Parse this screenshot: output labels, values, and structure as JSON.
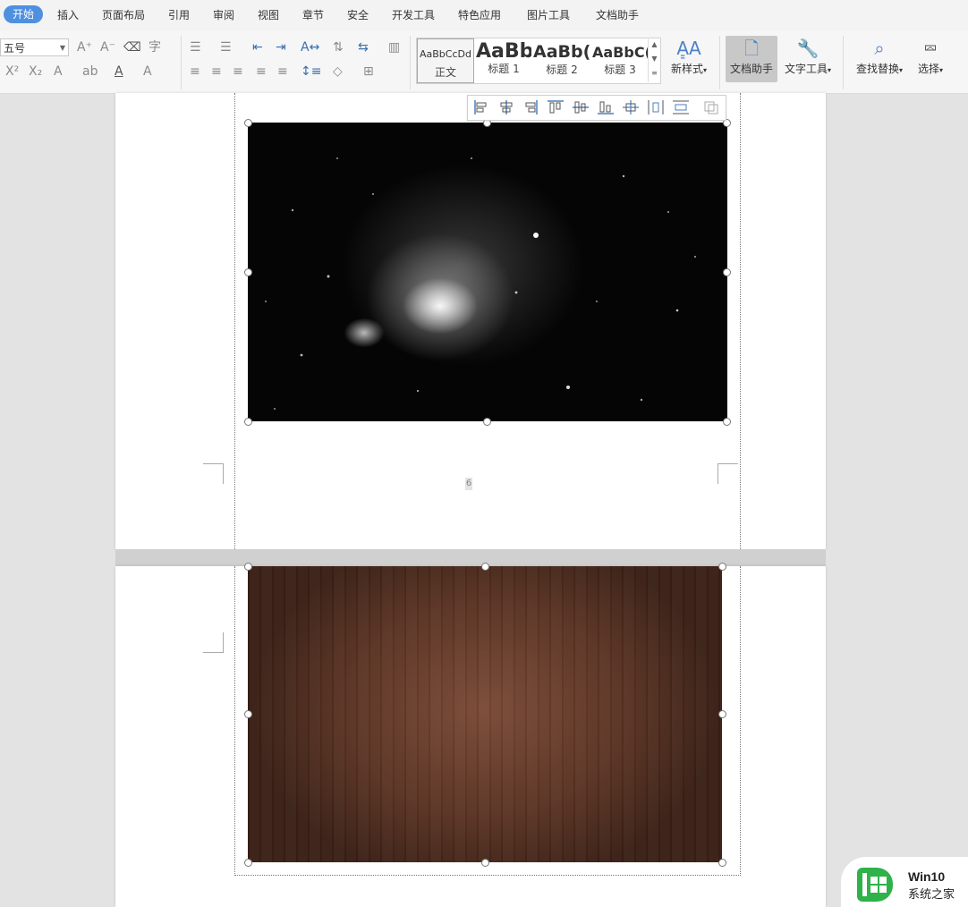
{
  "menu": {
    "items": [
      "开始",
      "插入",
      "页面布局",
      "引用",
      "审阅",
      "视图",
      "章节",
      "安全",
      "开发工具",
      "特色应用",
      "图片工具",
      "文档助手"
    ],
    "active_index": 0
  },
  "ribbon": {
    "font_size": "五号",
    "styles": [
      {
        "sample": "AaBbCcDd",
        "name": "正文"
      },
      {
        "sample": "AaBb",
        "name": "标题 1"
      },
      {
        "sample": "AaBb(",
        "name": "标题 2"
      },
      {
        "sample": "AaBbC(",
        "name": "标题 3"
      }
    ],
    "new_style_label": "新样式",
    "doc_helper_label": "文档助手",
    "text_tools_label": "文字工具",
    "find_replace_label": "查找替换",
    "select_label": "选择"
  },
  "document": {
    "page_number": "6"
  },
  "watermark": {
    "line1": "Win10",
    "line2": "系统之家"
  },
  "colors": {
    "accent": "#4e8fe0",
    "watermark_green": "#2fb24a"
  }
}
